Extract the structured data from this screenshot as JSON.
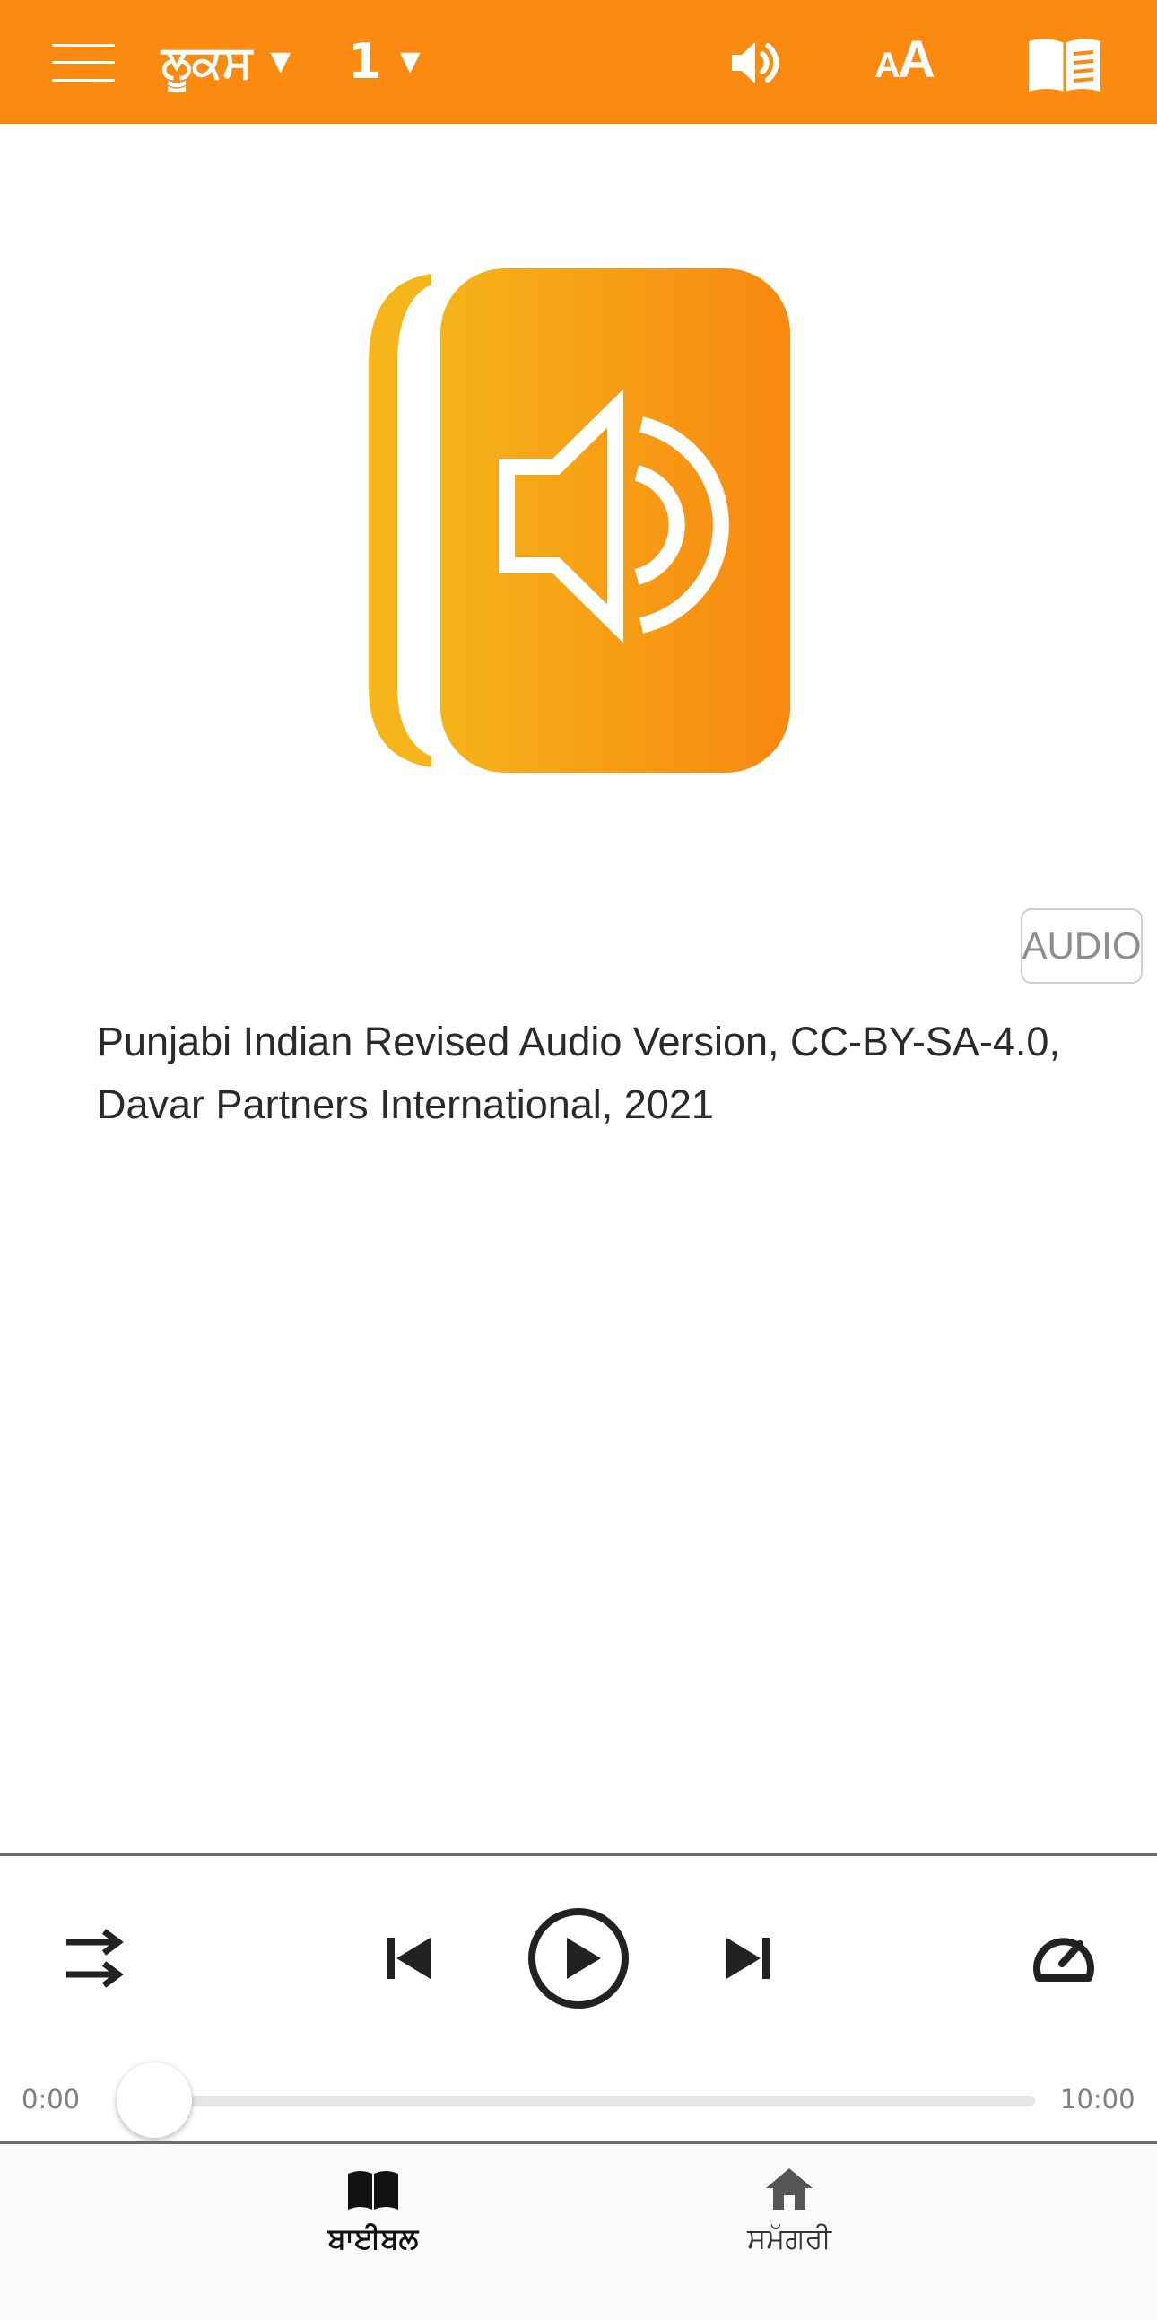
{
  "header": {
    "book": "ਲੂਕਸ",
    "book_caret": "▼",
    "chapter": "1",
    "chapter_caret": "▼",
    "icons": [
      "menu-icon",
      "speaker-icon",
      "font-size-icon",
      "reader-icon"
    ],
    "font_icon_small": "A",
    "font_icon_big": "A",
    "background_color": "#fa8a10"
  },
  "content": {
    "audio_badge": "AUDIO",
    "copyright": "Punjabi Indian Revised Audio Version, CC-BY-SA-4.0, Davar Partners International, 2021",
    "artwork_icon": "audio-book-icon"
  },
  "player": {
    "time_current": "0:00",
    "time_total": "10:00",
    "progress": 0,
    "icons": [
      "repeat-icon",
      "previous-icon",
      "play-icon",
      "next-icon",
      "speed-icon"
    ]
  },
  "tabs": [
    {
      "label": "ਬਾਈਬਲ",
      "icon": "book-open-icon",
      "active": true
    },
    {
      "label": "ਸਮੱਗਰੀ",
      "icon": "home-icon",
      "active": false
    }
  ]
}
